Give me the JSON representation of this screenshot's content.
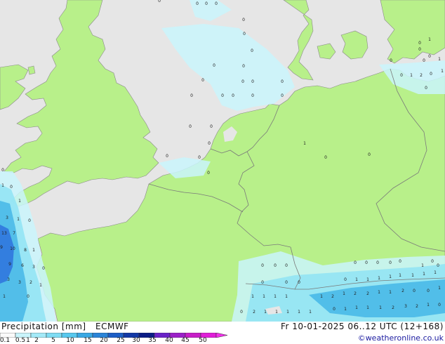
{
  "map": {
    "colors": {
      "sea": "#e6e6e6",
      "land": "#b8f08a",
      "border": "#7a7a7a",
      "coast": "#8a8a8a",
      "precip_light": "#c9f4fb",
      "precip_mid": "#8fe3f5",
      "precip_strong": "#40b4e6",
      "precip_heavy": "#2c6edc"
    },
    "values": [
      {
        "t": "0"
      },
      {
        "t": "0"
      },
      {
        "t": "0"
      },
      {
        "t": "0"
      },
      {
        "t": "0"
      },
      {
        "t": "0"
      },
      {
        "t": "0"
      },
      {
        "t": "0"
      },
      {
        "t": "0"
      },
      {
        "t": "0"
      },
      {
        "t": "0"
      },
      {
        "t": "0"
      },
      {
        "t": "0"
      },
      {
        "t": "0"
      },
      {
        "t": "0"
      },
      {
        "t": "0"
      },
      {
        "t": "0"
      },
      {
        "t": "0"
      },
      {
        "t": "0"
      },
      {
        "t": "0"
      },
      {
        "t": "1"
      },
      {
        "t": "0"
      },
      {
        "t": "0"
      },
      {
        "t": "0"
      },
      {
        "t": "0"
      },
      {
        "t": "0"
      },
      {
        "t": "0"
      },
      {
        "t": "0"
      },
      {
        "t": "0"
      },
      {
        "t": "1"
      },
      {
        "t": "0"
      },
      {
        "t": "0"
      },
      {
        "t": "1"
      },
      {
        "t": "2"
      },
      {
        "t": "0"
      },
      {
        "t": "1"
      },
      {
        "t": "0"
      },
      {
        "t": "1"
      },
      {
        "t": "0"
      },
      {
        "t": "0"
      },
      {
        "t": "0"
      },
      {
        "t": "1"
      },
      {
        "t": "0"
      },
      {
        "t": "1"
      },
      {
        "t": "3"
      },
      {
        "t": "1"
      },
      {
        "t": "0"
      },
      {
        "t": "13"
      },
      {
        "t": "7"
      },
      {
        "t": "9"
      },
      {
        "t": "10"
      },
      {
        "t": "8"
      },
      {
        "t": "1"
      },
      {
        "t": "9"
      },
      {
        "t": "6"
      },
      {
        "t": "3"
      },
      {
        "t": "0"
      },
      {
        "t": "3"
      },
      {
        "t": "3"
      },
      {
        "t": "2"
      },
      {
        "t": "1"
      },
      {
        "t": "1"
      },
      {
        "t": "0"
      },
      {
        "t": "0"
      },
      {
        "t": "0"
      },
      {
        "t": "0"
      },
      {
        "t": "0"
      },
      {
        "t": "0"
      },
      {
        "t": "0"
      },
      {
        "t": "0"
      },
      {
        "t": "0"
      },
      {
        "t": "0"
      },
      {
        "t": "0"
      },
      {
        "t": "0"
      },
      {
        "t": "0"
      },
      {
        "t": "1"
      },
      {
        "t": "1"
      },
      {
        "t": "1"
      },
      {
        "t": "1"
      },
      {
        "t": "1"
      },
      {
        "t": "1"
      },
      {
        "t": "1"
      },
      {
        "t": "1"
      },
      {
        "t": "1"
      },
      {
        "t": "1"
      },
      {
        "t": "1"
      },
      {
        "t": "1"
      },
      {
        "t": "1"
      },
      {
        "t": "2"
      },
      {
        "t": "1"
      },
      {
        "t": "2"
      },
      {
        "t": "2"
      },
      {
        "t": "1"
      },
      {
        "t": "1"
      },
      {
        "t": "2"
      },
      {
        "t": "0"
      },
      {
        "t": "0"
      },
      {
        "t": "1"
      },
      {
        "t": "0"
      },
      {
        "t": "2"
      },
      {
        "t": "1"
      },
      {
        "t": "1"
      },
      {
        "t": "1"
      },
      {
        "t": "1"
      },
      {
        "t": "1"
      },
      {
        "t": "0"
      },
      {
        "t": "1"
      },
      {
        "t": "1"
      },
      {
        "t": "1"
      },
      {
        "t": "1"
      },
      {
        "t": "2"
      },
      {
        "t": "3"
      },
      {
        "t": "2"
      },
      {
        "t": "1"
      },
      {
        "t": "0"
      },
      {
        "t": "0"
      },
      {
        "t": "0"
      },
      {
        "t": "1"
      }
    ]
  },
  "legend": {
    "title": "Precipitation [mm]",
    "model": "ECMWF",
    "scale_labels": [
      "0.1",
      "0.5",
      "1",
      "2",
      "5",
      "10",
      "15",
      "20",
      "25",
      "30",
      "35",
      "40",
      "45",
      "50"
    ],
    "scale_colors": [
      "#fafafa",
      "#c9f4fb",
      "#a4eaf8",
      "#7fdcf3",
      "#58c8ee",
      "#3aa8e4",
      "#2a84d8",
      "#1c5ec6",
      "#1238a6",
      "#0b1c86",
      "#6a22c8",
      "#9c20c8",
      "#c81ec8",
      "#e01ed8",
      "#f030e8"
    ]
  },
  "valid_time": "Fr 10-01-2025 06..12 UTC (12+168)",
  "credit": "©weatheronline.co.uk"
}
